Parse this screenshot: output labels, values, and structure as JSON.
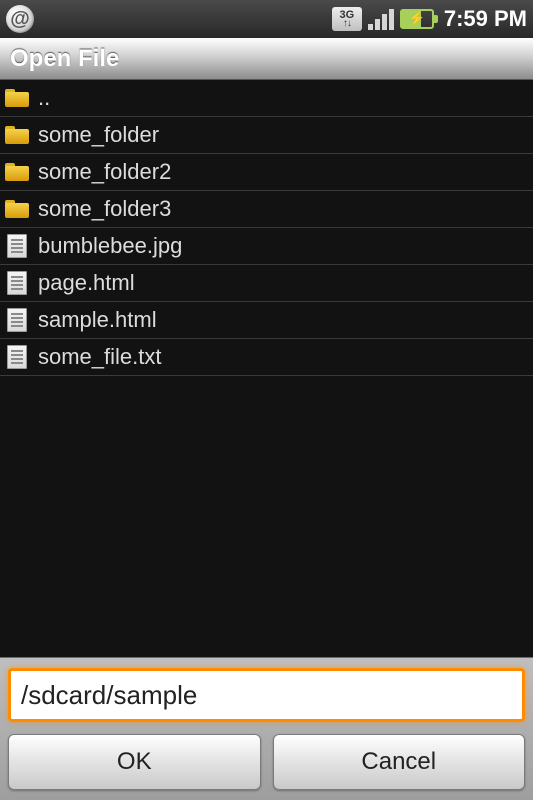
{
  "status": {
    "app_icon": "@",
    "network_label": "3G",
    "time": "7:59 PM"
  },
  "title": "Open File",
  "files": [
    {
      "type": "folder",
      "name": ".."
    },
    {
      "type": "folder",
      "name": "some_folder"
    },
    {
      "type": "folder",
      "name": "some_folder2"
    },
    {
      "type": "folder",
      "name": "some_folder3"
    },
    {
      "type": "file",
      "name": "bumblebee.jpg"
    },
    {
      "type": "file",
      "name": "page.html"
    },
    {
      "type": "file",
      "name": "sample.html"
    },
    {
      "type": "file",
      "name": "some_file.txt"
    }
  ],
  "path_input": {
    "value": "/sdcard/sample"
  },
  "buttons": {
    "ok": "OK",
    "cancel": "Cancel"
  }
}
